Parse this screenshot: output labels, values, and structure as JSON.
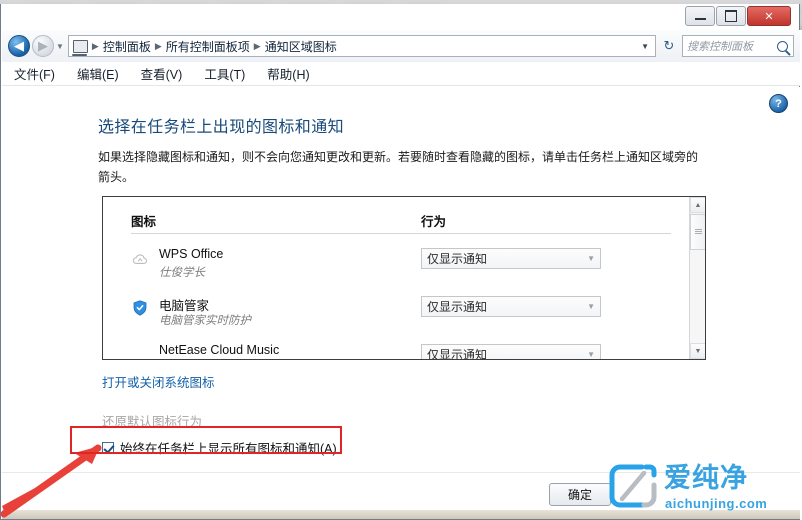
{
  "window": {
    "controls": {
      "minimize_label": "最小化",
      "maximize_label": "最大化",
      "close_label": "✕"
    }
  },
  "nav": {
    "back_label": "◀",
    "forward_label": "▶",
    "history_chevron": "▼",
    "computer_icon": "computer-icon",
    "breadcrumbs": [
      "控制面板",
      "所有控制面板项",
      "通知区域图标"
    ],
    "separator": "▶",
    "address_chevron": "▼",
    "refresh_label": "↻",
    "search": {
      "placeholder": "搜索控制面板",
      "value": ""
    }
  },
  "menubar": {
    "items": [
      "文件(F)",
      "编辑(E)",
      "查看(V)",
      "工具(T)",
      "帮助(H)"
    ]
  },
  "content": {
    "help_label": "?",
    "heading": "选择在任务栏上出现的图标和通知",
    "description": "如果选择隐藏图标和通知，则不会向您通知更改和更新。若要随时查看隐藏的图标，请单击任务栏上通知区域旁的箭头。",
    "table": {
      "columns": [
        "图标",
        "行为"
      ],
      "rows": [
        {
          "icon": "wps-cloud-icon",
          "name": "WPS Office",
          "subtitle": "仕俊学长",
          "behavior": "仅显示通知",
          "chevron": "▼"
        },
        {
          "icon": "shield-icon",
          "name": "电脑管家",
          "subtitle": "电脑管家实时防护",
          "behavior": "仅显示通知",
          "chevron": "▼"
        },
        {
          "icon": "netease-music-icon",
          "name": "NetEase Cloud Music",
          "subtitle": "",
          "behavior": "仅显示通知",
          "chevron": "▼"
        }
      ]
    },
    "scrollbar": {
      "up_arrow": "▲",
      "down_arrow": "▼"
    },
    "links": {
      "system_icons": "打开或关闭系统图标",
      "restore_defaults": "还原默认图标行为"
    },
    "checkbox": {
      "label": "始终在任务栏上显示所有图标和通知(A)",
      "checked": true
    }
  },
  "footer": {
    "ok_label": "确定"
  },
  "watermark": {
    "brand": "爱纯净",
    "url": "aichunjing.com",
    "color": "#38a3e0"
  },
  "annotations": {
    "highlight_color": "#e02525",
    "arrow_color": "#e8413a"
  }
}
